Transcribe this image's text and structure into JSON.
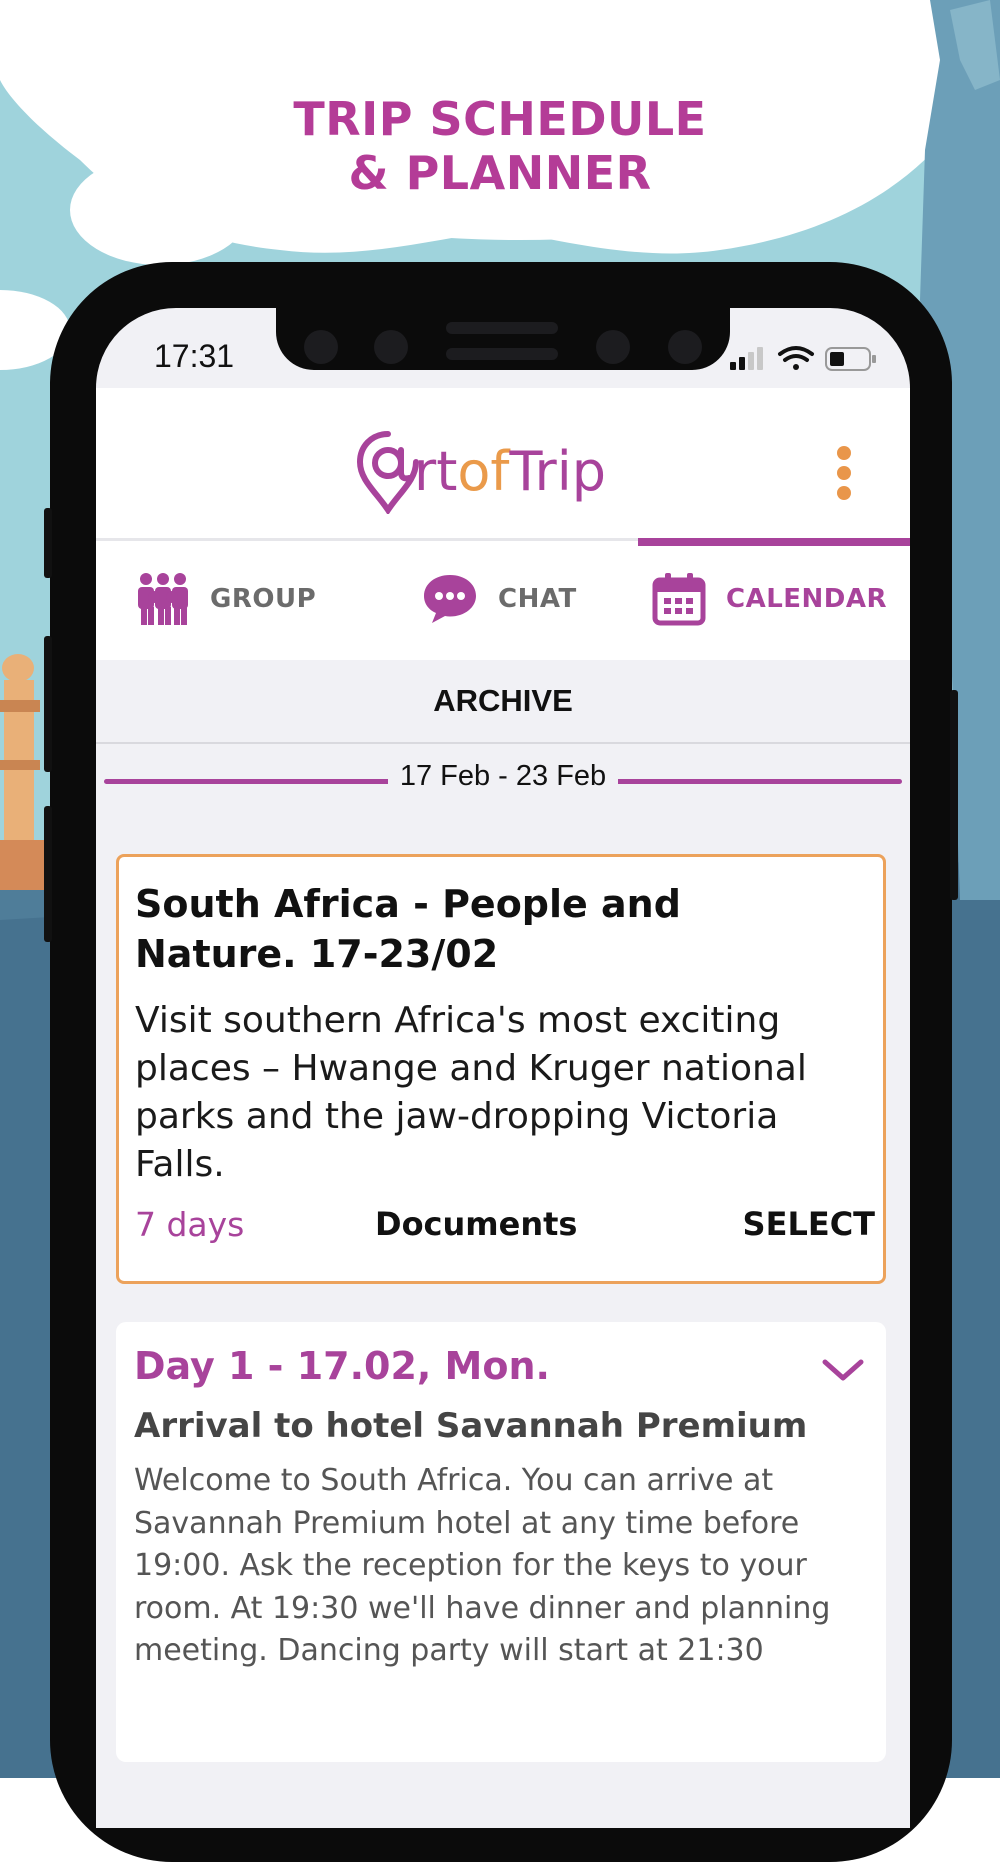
{
  "headline": {
    "line1": "TRIP SCHEDULE",
    "line2": "& PLANNER"
  },
  "status_bar": {
    "time": "17:31",
    "icons": [
      "signal-icon",
      "wifi-icon",
      "battery-icon"
    ]
  },
  "app": {
    "logo": {
      "part1": "rt",
      "part2": "of",
      "part3": "Trip",
      "mark": "map-pin-at-icon"
    },
    "menu_icon": "more-vertical-icon"
  },
  "tabs": [
    {
      "label": "GROUP",
      "icon": "group-icon",
      "active": false
    },
    {
      "label": "CHAT",
      "icon": "chat-bubble-icon",
      "active": false
    },
    {
      "label": "CALENDAR",
      "icon": "calendar-icon",
      "active": true
    }
  ],
  "archive": {
    "label": "ARCHIVE"
  },
  "date_range": "17 Feb - 23 Feb",
  "trip": {
    "title": "South Africa - People and Nature. 17-23/02",
    "description": "Visit southern Africa's most exciting places – Hwange and Kruger national parks and the jaw-dropping Victoria Falls.",
    "days": "7 days",
    "documents": "Documents",
    "select": "SELECT"
  },
  "day": {
    "title": "Day 1 - 17.02, Mon.",
    "subtitle": "Arrival to hotel Savannah Premium",
    "text": "Welcome to South Africa. You can arrive at Savannah Premium hotel at any time before 19:00. Ask the reception for the keys to your room. At 19:30 we'll have dinner and planning meeting. Dancing party will start at 21:30"
  },
  "colors": {
    "brand_purple": "#a8439b",
    "brand_orange": "#ea9a4a",
    "headline": "#b43c97",
    "background_sky": "#9fd3dc",
    "background_blue": "#4f7d99"
  }
}
